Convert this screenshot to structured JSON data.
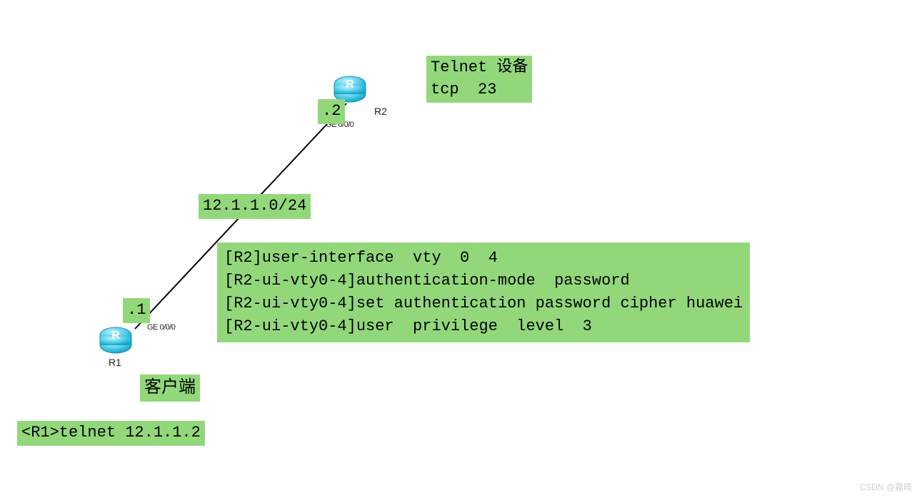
{
  "title_box": {
    "line1": "Telnet 设备",
    "line2": "tcp  23"
  },
  "routers": {
    "r2": {
      "name": "R2",
      "port": "GE 0/0/0",
      "host_suffix": ".2"
    },
    "r1": {
      "name": "R1",
      "port": "GE 0/0/0",
      "host_suffix": ".1"
    }
  },
  "network": "12.1.1.0/24",
  "client_label": "客户端",
  "r1_command": "<R1>telnet 12.1.1.2",
  "r2_config": {
    "l1": "[R2]user-interface  vty  0  4",
    "l2": "[R2-ui-vty0-4]authentication-mode  password",
    "l3": "[R2-ui-vty0-4]set authentication password cipher huawei",
    "l4": "[R2-ui-vty0-4]user  privilege  level  3"
  },
  "watermark": "CSDN @霜晴"
}
